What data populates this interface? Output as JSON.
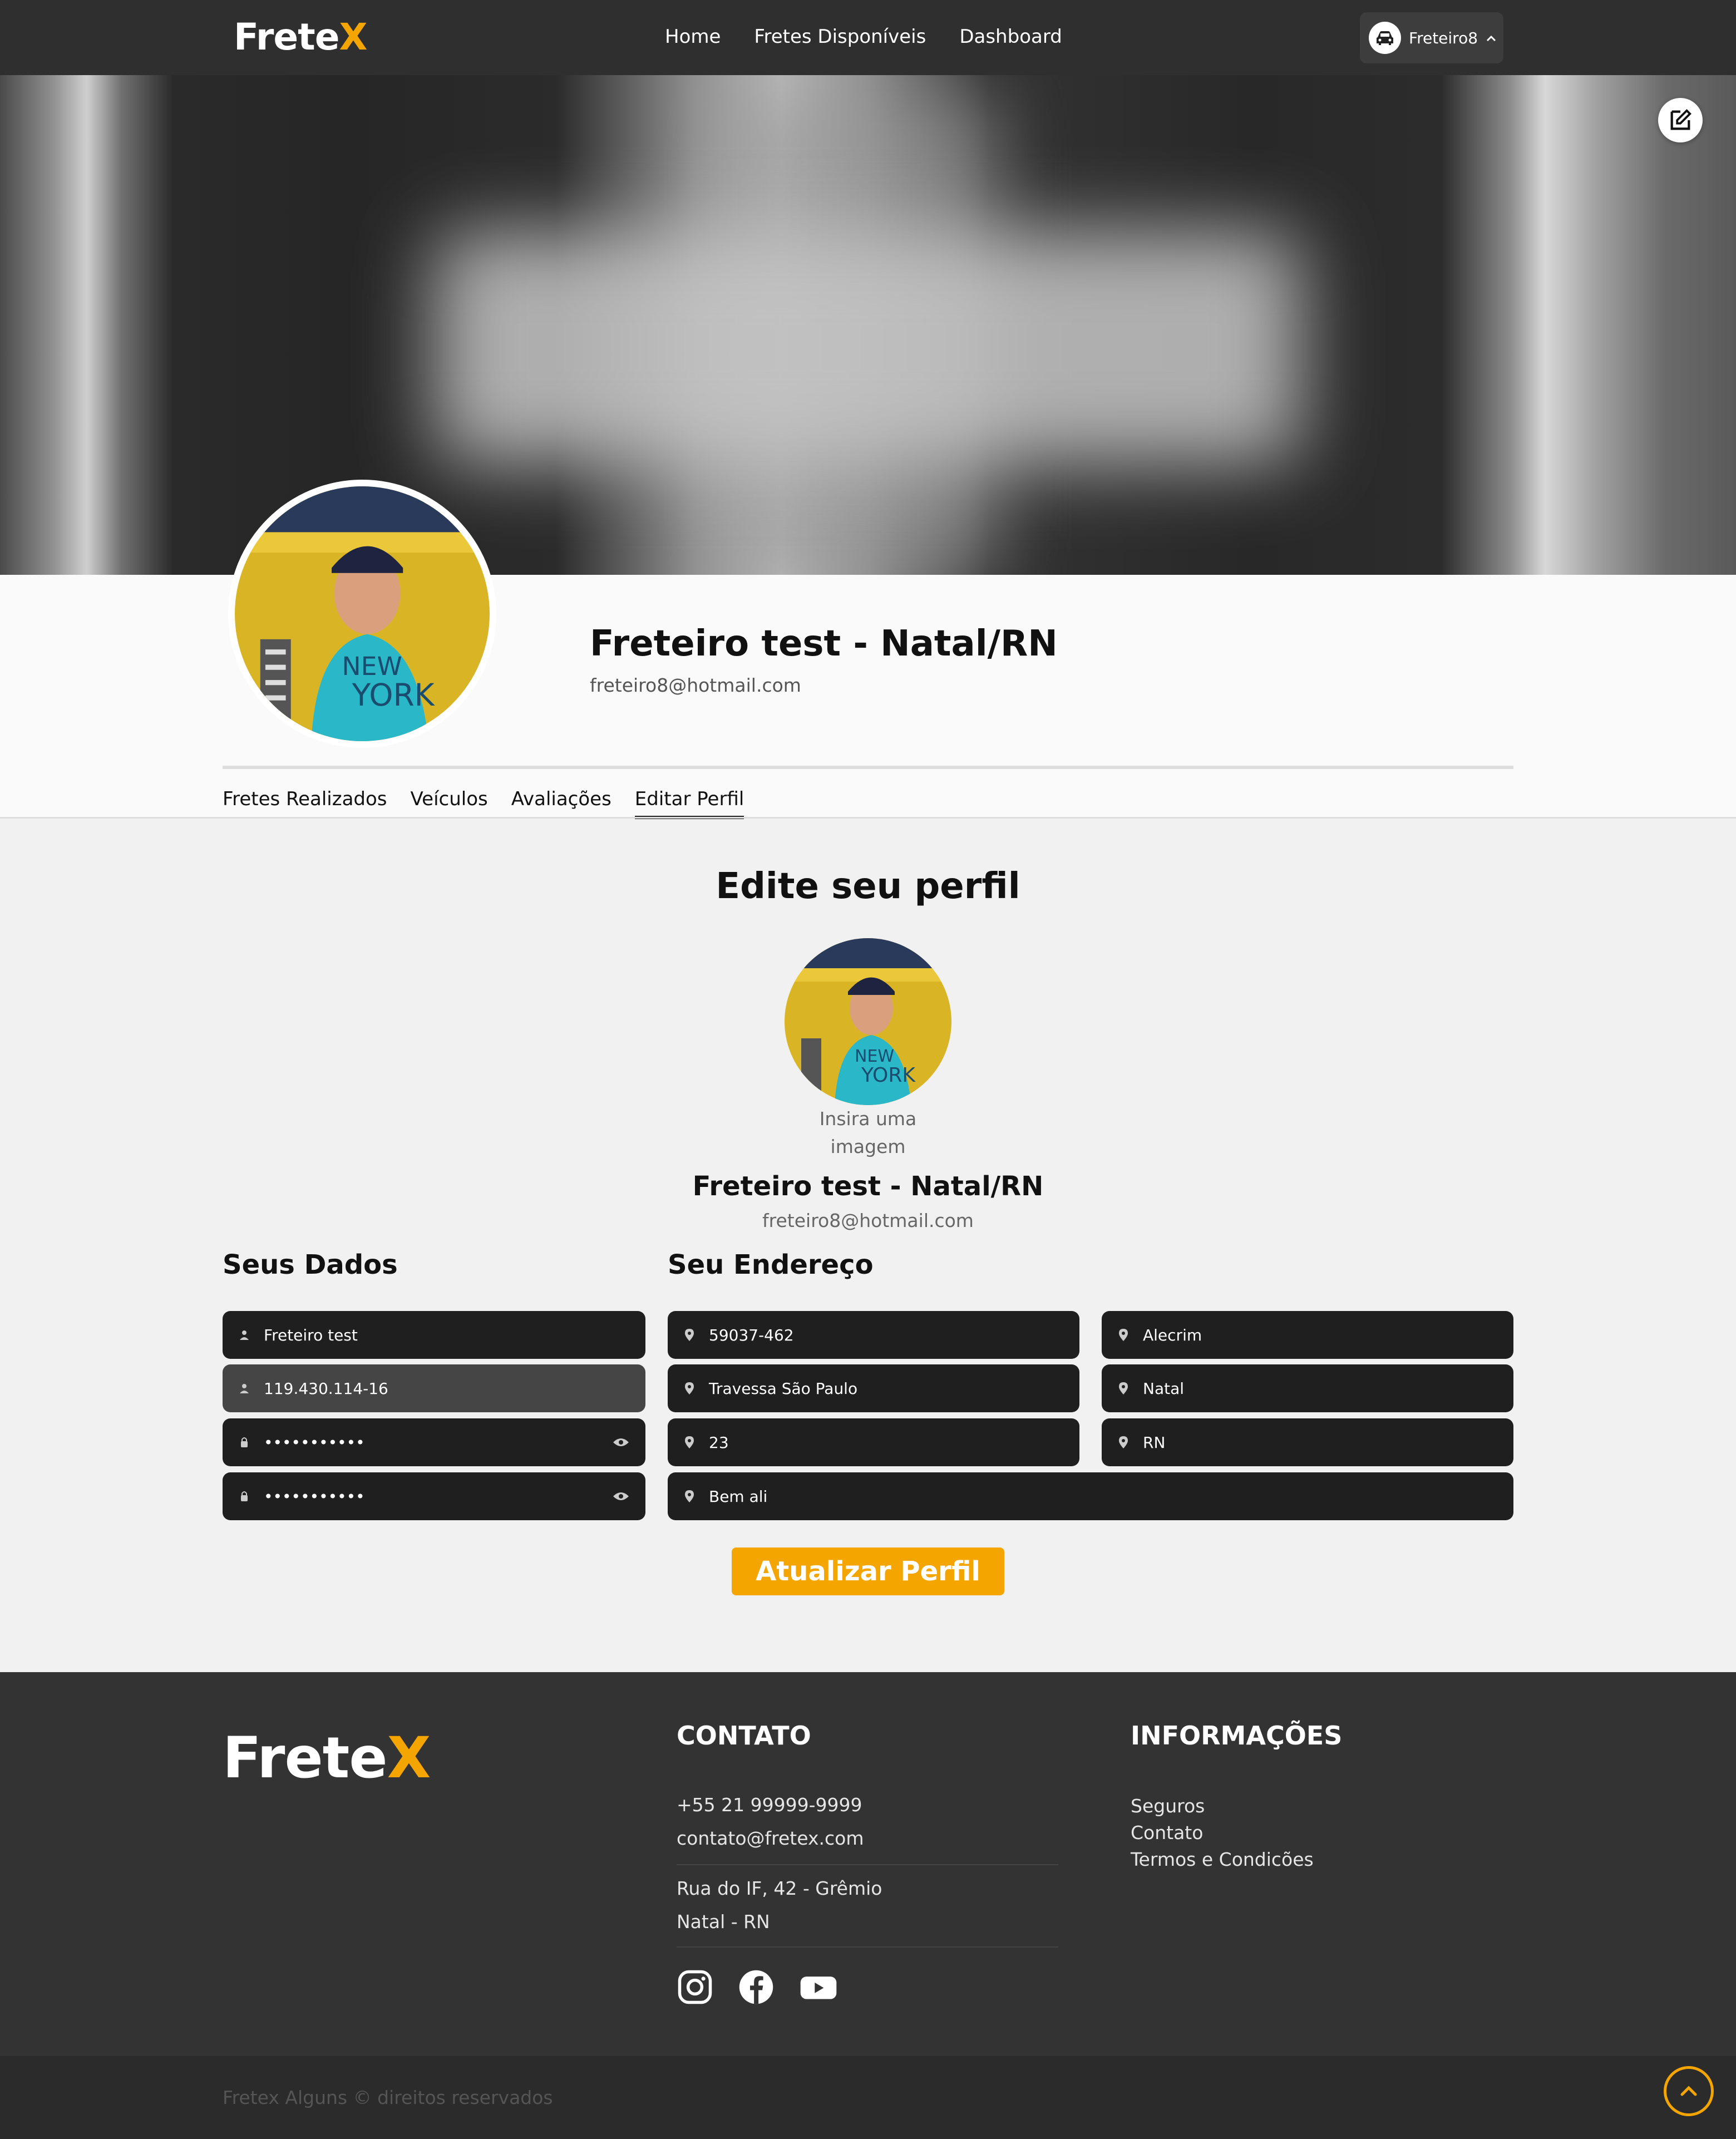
{
  "nav": {
    "brand_main": "Frete",
    "brand_accent": "X",
    "links": [
      "Home",
      "Fretes Disponíveis",
      "Dashboard"
    ],
    "user": "Freteiro8"
  },
  "profile": {
    "name": "Freteiro test - Natal/RN",
    "email": "freteiro8@hotmail.com",
    "tabs": [
      "Fretes Realizados",
      "Veículos",
      "Avaliações",
      "Editar Perfil"
    ],
    "active_tab": "Editar Perfil"
  },
  "edit": {
    "title": "Edite seu perfil",
    "image_hint_line1": "Insira uma",
    "image_hint_line2": "imagem",
    "name": "Freteiro test - Natal/RN",
    "email": "freteiro8@hotmail.com",
    "data_heading": "Seus Dados",
    "address_heading": "Seu Endereço",
    "data_fields": {
      "name": "Freteiro test",
      "cpf": "119.430.114-16",
      "password": "•••••••••••",
      "password_confirm": "•••••••••••"
    },
    "address_fields": {
      "cep": "59037-462",
      "street": "Travessa São Paulo",
      "number": "23",
      "complement": "Bem ali",
      "neighborhood": "Alecrim",
      "city": "Natal",
      "state": "RN"
    },
    "submit": "Atualizar Perfil"
  },
  "footer": {
    "brand_main": "Frete",
    "brand_accent": "X",
    "contact_heading": "CONTATO",
    "phone": "+55 21 99999-9999",
    "email": "contato@fretex.com",
    "address_line1": "Rua do IF, 42 - Grêmio",
    "address_line2": "Natal - RN",
    "info_heading": "INFORMAÇÕES",
    "info_links": [
      "Seguros",
      "Contato",
      "Termos e Condicões"
    ],
    "copyright": "Fretex Alguns © direitos reservados"
  },
  "colors": {
    "accent": "#f5a500",
    "nav_bg": "#2f2f2f",
    "field_bg": "#1f1f1f",
    "footer_bg": "#333333"
  },
  "icons": [
    "car-icon",
    "chevron-up-icon",
    "edit-icon",
    "user-icon",
    "lock-icon",
    "eye-icon",
    "location-pin-icon",
    "instagram-icon",
    "facebook-icon",
    "youtube-icon",
    "arrow-up-icon"
  ]
}
